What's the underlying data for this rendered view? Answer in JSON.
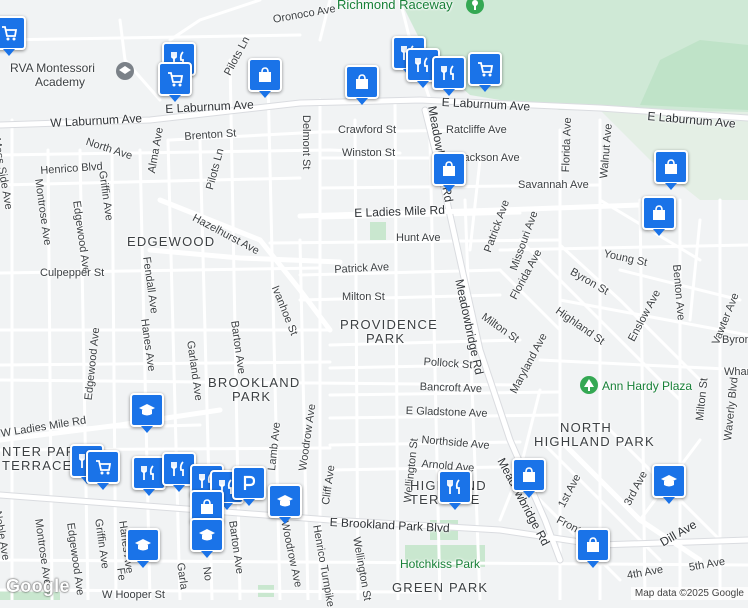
{
  "map": {
    "streets": [
      {
        "id": "oronoco-ave",
        "text": "Oronoco Ave"
      },
      {
        "id": "pilots-ln-north",
        "text": "Pilots Ln"
      },
      {
        "id": "w-laburnum-ave",
        "text": "W Laburnum Ave"
      },
      {
        "id": "e-laburnum-ave",
        "text": "E Laburnum Ave"
      },
      {
        "id": "e-laburnum-ave-east",
        "text": "E Laburnum Ave"
      },
      {
        "id": "brenton-st",
        "text": "Brenton St"
      },
      {
        "id": "crawford-st",
        "text": "Crawford St"
      },
      {
        "id": "ratcliffe-ave",
        "text": "Ratcliffe Ave"
      },
      {
        "id": "north-ave",
        "text": "North Ave"
      },
      {
        "id": "alma-ave",
        "text": "Alma Ave"
      },
      {
        "id": "delmont-st",
        "text": "Delmont St"
      },
      {
        "id": "meadowbridge-rd-north",
        "text": "Meadowbridge Rd"
      },
      {
        "id": "florida-ave-north",
        "text": "Florida Ave"
      },
      {
        "id": "walnut-ave",
        "text": "Walnut Ave"
      },
      {
        "id": "moss-side-ave",
        "text": "Moss Side Ave"
      },
      {
        "id": "henrico-blvd",
        "text": "Henrico Blvd"
      },
      {
        "id": "winston-st",
        "text": "Winston St"
      },
      {
        "id": "jackson-ave",
        "text": "Jackson Ave"
      },
      {
        "id": "pilots-ln",
        "text": "Pilots Ln"
      },
      {
        "id": "savannah-ave",
        "text": "Savannah Ave"
      },
      {
        "id": "montrose-ave-north",
        "text": "Montrose Ave"
      },
      {
        "id": "griffin-ave-north",
        "text": "Griffin Ave"
      },
      {
        "id": "edgewood-ave-north",
        "text": "Edgewood Ave"
      },
      {
        "id": "hazelhurst-ave",
        "text": "Hazelhurst Ave"
      },
      {
        "id": "e-ladies-mile-rd",
        "text": "E Ladies Mile Rd"
      },
      {
        "id": "hunt-ave",
        "text": "Hunt Ave"
      },
      {
        "id": "patrick-ave-east",
        "text": "Patrick Ave"
      },
      {
        "id": "missouri-ave",
        "text": "Missouri Ave"
      },
      {
        "id": "young-st",
        "text": "Young St"
      },
      {
        "id": "culpepper-st",
        "text": "Culpepper St"
      },
      {
        "id": "fendall-ave",
        "text": "Fendall Ave"
      },
      {
        "id": "patrick-ave",
        "text": "Patrick Ave"
      },
      {
        "id": "florida-ave",
        "text": "Florida Ave"
      },
      {
        "id": "byron-st",
        "text": "Byron St"
      },
      {
        "id": "benton-ave",
        "text": "Benton Ave"
      },
      {
        "id": "milton-st",
        "text": "Milton St"
      },
      {
        "id": "meadowbridge-rd",
        "text": "Meadowbridge Rd"
      },
      {
        "id": "milton-st-east",
        "text": "Milton St"
      },
      {
        "id": "highland-st",
        "text": "Highland St"
      },
      {
        "id": "enslow-ave",
        "text": "Enslow Ave"
      },
      {
        "id": "vawter-ave",
        "text": "Vawter Ave"
      },
      {
        "id": "byron-st-east",
        "text": "Byron"
      },
      {
        "id": "hanes-ave",
        "text": "Hanes Ave"
      },
      {
        "id": "ivanhoe-st",
        "text": "Ivanhoe St"
      },
      {
        "id": "edgewood-ave",
        "text": "Edgewood Ave"
      },
      {
        "id": "barton-ave",
        "text": "Barton Ave"
      },
      {
        "id": "garland-ave",
        "text": "Garland Ave"
      },
      {
        "id": "pollock-st",
        "text": "Pollock St"
      },
      {
        "id": "maryland-ave",
        "text": "Maryland Ave"
      },
      {
        "id": "whar",
        "text": "Whar"
      },
      {
        "id": "bancroft-ave",
        "text": "Bancroft Ave"
      },
      {
        "id": "w-ladies-mile-rd",
        "text": "W Ladies Mile Rd"
      },
      {
        "id": "e-gladstone-ave",
        "text": "E Gladstone Ave"
      },
      {
        "id": "woodrow-ave-north",
        "text": "Woodrow Ave"
      },
      {
        "id": "northside-ave",
        "text": "Northside Ave"
      },
      {
        "id": "milton-st-se",
        "text": "Milton St"
      },
      {
        "id": "waverly-blvd",
        "text": "Waverly Blvd"
      },
      {
        "id": "lamb-ave",
        "text": "Lamb Ave"
      },
      {
        "id": "arnold-ave",
        "text": "Arnold Ave"
      },
      {
        "id": "wellington-st-north",
        "text": "Wellington St"
      },
      {
        "id": "cliff-ave",
        "text": "Cliff Ave"
      },
      {
        "id": "meadowbridge-rd-south",
        "text": "Meadowbridge Rd"
      },
      {
        "id": "1st-ave",
        "text": "1st Ave"
      },
      {
        "id": "3rd-ave",
        "text": "3rd Ave"
      },
      {
        "id": "front-st",
        "text": "Front St"
      },
      {
        "id": "dill-ave",
        "text": "Dill Ave"
      },
      {
        "id": "montrose-ave",
        "text": "Montrose Ave"
      },
      {
        "id": "griffin-ave",
        "text": "Griffin Ave"
      },
      {
        "id": "edgewood-ave-south",
        "text": "Edgewood Ave"
      },
      {
        "id": "hanes-ave-south",
        "text": "Hanes Ave"
      },
      {
        "id": "woodrow-ave",
        "text": "Woodrow Ave"
      },
      {
        "id": "barton-ave-south",
        "text": "Barton Ave"
      },
      {
        "id": "henrico-turnpike",
        "text": "Henrico Turnpike"
      },
      {
        "id": "wellington-st",
        "text": "Wellington St"
      },
      {
        "id": "e-brookland-park-blvd",
        "text": "E Brookland Park Blvd"
      },
      {
        "id": "noble-ave",
        "text": "Noble Ave"
      },
      {
        "id": "4th-ave",
        "text": "4th Ave"
      },
      {
        "id": "5th-ave",
        "text": "5th Ave"
      },
      {
        "id": "w-hooper-st",
        "text": "W Hooper St"
      },
      {
        "id": "fe",
        "text": "Fe"
      },
      {
        "id": "garla",
        "text": "Garla"
      },
      {
        "id": "no",
        "text": "No"
      }
    ],
    "neighborhoods": [
      {
        "id": "edgewood",
        "text": "EDGEWOOD"
      },
      {
        "id": "providence-park-1",
        "text": "PROVIDENCE"
      },
      {
        "id": "providence-park-2",
        "text": "PARK"
      },
      {
        "id": "brookland-park-1",
        "text": "BROOKLAND"
      },
      {
        "id": "brookland-park-2",
        "text": "PARK"
      },
      {
        "id": "north-highland-park-1",
        "text": "NORTH"
      },
      {
        "id": "north-highland-park-2",
        "text": "HIGHLAND PARK"
      },
      {
        "id": "highland-terrace-1",
        "text": "HIGHLAND"
      },
      {
        "id": "highland-terrace-2",
        "text": "TERRACE"
      },
      {
        "id": "center-park-terrace-1",
        "text": "NTER PARK"
      },
      {
        "id": "center-park-terrace-2",
        "text": "TERRACE"
      },
      {
        "id": "green-park",
        "text": "GREEN PARK"
      }
    ],
    "pois": [
      {
        "id": "richmond-raceway",
        "text": "Richmond Raceway",
        "icon": "landmark-icon"
      },
      {
        "id": "rva-montessori",
        "text": "RVA Montessori",
        "text2": "Academy",
        "icon": "school-icon"
      },
      {
        "id": "ann-hardy-plaza",
        "text": "Ann Hardy Plaza",
        "icon": "tree-icon"
      },
      {
        "id": "hotchkiss-park",
        "text": "Hotchkiss Park",
        "icon": "park-icon"
      }
    ],
    "markers": [
      {
        "id": "m1",
        "icon": "shopping-cart-icon"
      },
      {
        "id": "m2",
        "icon": "restaurant-icon"
      },
      {
        "id": "m3",
        "icon": "shopping-cart-icon"
      },
      {
        "id": "m4",
        "icon": "shopping-bag-icon"
      },
      {
        "id": "m5",
        "icon": "shopping-bag-icon"
      },
      {
        "id": "m6",
        "icon": "restaurant-icon"
      },
      {
        "id": "m7",
        "icon": "restaurant-icon"
      },
      {
        "id": "m8",
        "icon": "restaurant-icon"
      },
      {
        "id": "m9",
        "icon": "shopping-cart-icon"
      },
      {
        "id": "m10",
        "icon": "shopping-bag-icon"
      },
      {
        "id": "m11",
        "icon": "shopping-bag-icon"
      },
      {
        "id": "m12",
        "icon": "shopping-bag-icon"
      },
      {
        "id": "m13",
        "icon": "school-icon"
      },
      {
        "id": "m14",
        "icon": "restaurant-icon"
      },
      {
        "id": "m15",
        "icon": "shopping-cart-icon"
      },
      {
        "id": "m16",
        "icon": "restaurant-icon"
      },
      {
        "id": "m17",
        "icon": "restaurant-icon"
      },
      {
        "id": "m18",
        "icon": "restaurant-icon"
      },
      {
        "id": "m19",
        "icon": "restaurant-icon"
      },
      {
        "id": "m20",
        "icon": "parking-icon"
      },
      {
        "id": "m21",
        "icon": "shopping-bag-icon"
      },
      {
        "id": "m22",
        "icon": "school-icon"
      },
      {
        "id": "m23",
        "icon": "school-icon"
      },
      {
        "id": "m24",
        "icon": "school-icon"
      },
      {
        "id": "m25",
        "icon": "restaurant-icon"
      },
      {
        "id": "m26",
        "icon": "shopping-bag-icon"
      },
      {
        "id": "m27",
        "icon": "school-icon"
      },
      {
        "id": "m28",
        "icon": "shopping-bag-icon"
      },
      {
        "id": "m29",
        "icon": "shopping-bag-icon"
      },
      {
        "id": "m30",
        "icon": "shopping-cart-icon"
      }
    ],
    "attribution": "Map data ©2025 Google",
    "logo": "Google"
  }
}
